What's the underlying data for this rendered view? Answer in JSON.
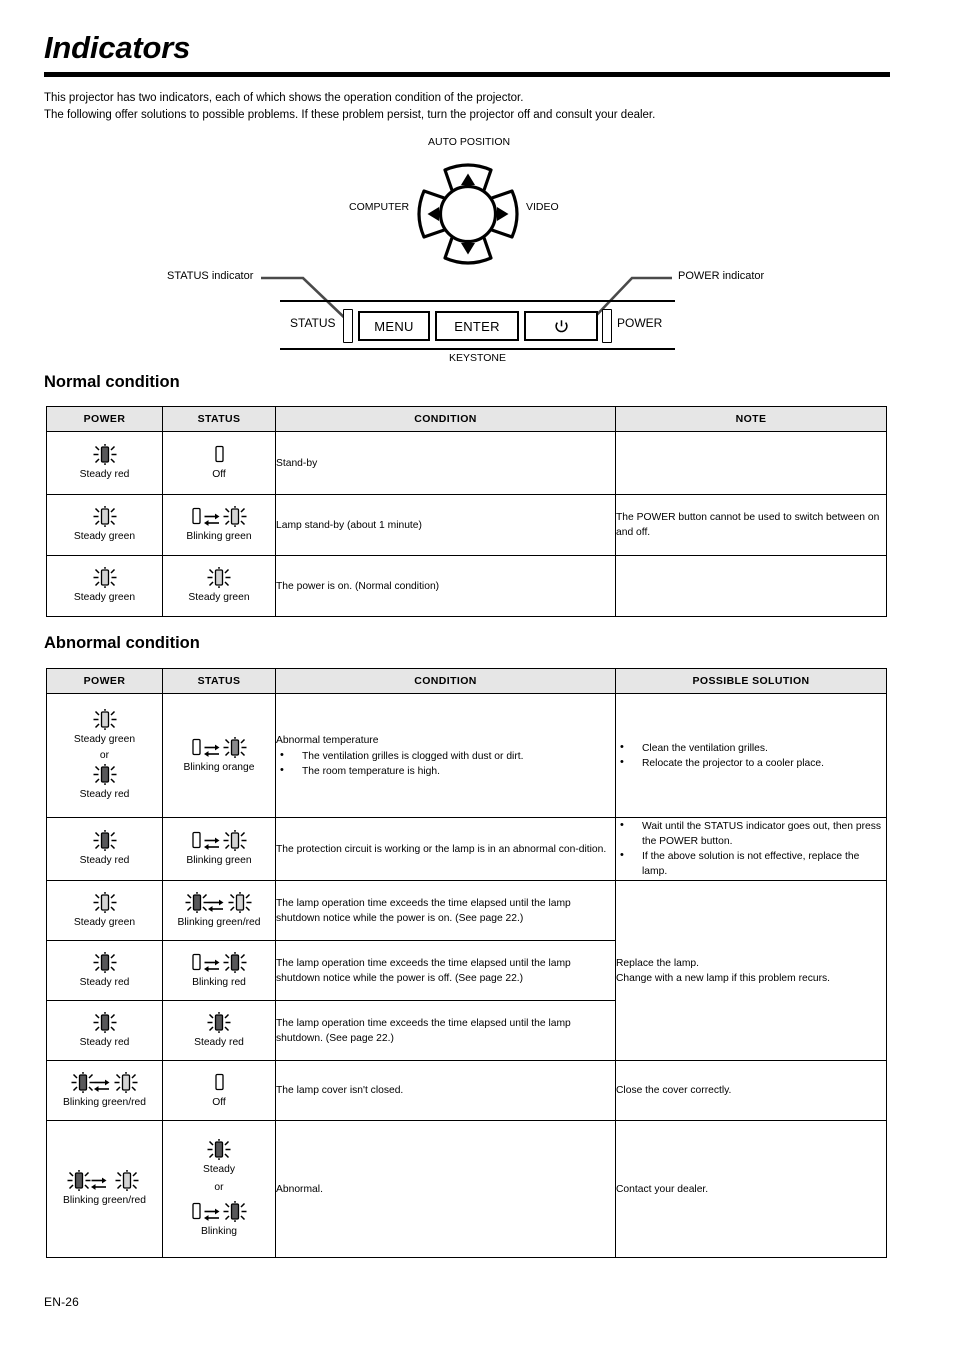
{
  "page": {
    "title": "Indicators",
    "footer": "EN-26",
    "intro_lines": [
      "This projector has two indicators, each of which shows the operation condition of the projector.",
      "The following offer solutions to possible problems. If these problem persist, turn the projector off and consult your dealer."
    ]
  },
  "diagram": {
    "auto_position": "AUTO POSITION",
    "computer": "COMPUTER",
    "video": "VIDEO",
    "status_indicator_label": "STATUS indicator",
    "power_indicator_label": "POWER indicator",
    "status_label": "STATUS",
    "power_label": "POWER",
    "menu_button": "MENU",
    "enter_button": "ENTER",
    "power_button_icon": "power-symbol",
    "keystone": "KEYSTONE"
  },
  "normal": {
    "heading": "Normal condition",
    "columns": [
      "POWER",
      "STATUS",
      "CONDITION",
      "NOTE"
    ],
    "rows": [
      {
        "power": {
          "caption": "Steady red",
          "symbol": "steady-red"
        },
        "status": {
          "caption": "Off",
          "symbol": "off"
        },
        "condition": "Stand-by",
        "note": ""
      },
      {
        "power": {
          "caption": "Steady green",
          "symbol": "steady-green"
        },
        "status": {
          "caption": "Blinking  green",
          "symbol": "blinking-green"
        },
        "condition": "Lamp stand-by (about 1 minute)",
        "note": "The POWER button cannot be used to switch between on and off."
      },
      {
        "power": {
          "caption": "Steady green",
          "symbol": "steady-green"
        },
        "status": {
          "caption": "Steady green",
          "symbol": "steady-green"
        },
        "condition": "The power is on. (Normal condition)",
        "note": ""
      }
    ]
  },
  "abnormal": {
    "heading": "Abnormal condition",
    "columns": [
      "POWER",
      "STATUS",
      "CONDITION",
      "POSSIBLE SOLUTION"
    ],
    "rows": [
      {
        "power": {
          "caption": "Steady green",
          "symbol": "steady-green",
          "or": "or",
          "caption2": "Steady red",
          "symbol2": "steady-red"
        },
        "status": {
          "caption": "Blinking orange",
          "symbol": "blinking-orange"
        },
        "condition_title": "Abnormal temperature",
        "condition_bullets": [
          "The ventilation grilles is clogged with dust or dirt.",
          "The room temperature is high."
        ],
        "solution_bullets": [
          "Clean the ventilation grilles.",
          "Relocate the projector to a cooler place."
        ]
      },
      {
        "power": {
          "caption": "Steady red",
          "symbol": "steady-red"
        },
        "status": {
          "caption": "Blinking  green",
          "symbol": "blinking-green"
        },
        "condition": "The protection circuit is working or the lamp is in an abnormal con-dition.",
        "solution_bullets": [
          "Wait until the STATUS indicator goes out, then press the POWER button.",
          "If the above solution is not effective, replace the lamp."
        ]
      },
      {
        "power": {
          "caption": "Steady green",
          "symbol": "steady-green"
        },
        "status": {
          "caption": "Blinking green/red",
          "symbol": "blinking-green-red"
        },
        "condition": "The lamp operation time exceeds the time elapsed until the lamp shutdown notice while the power is on. (See page 22.)"
      },
      {
        "power": {
          "caption": "Steady red",
          "symbol": "steady-red"
        },
        "status": {
          "caption": "Blinking red",
          "symbol": "blinking-red"
        },
        "condition": "The lamp operation time exceeds the time elapsed until the lamp shutdown notice while the power is off. (See page 22.)"
      },
      {
        "power": {
          "caption": "Steady red",
          "symbol": "steady-red"
        },
        "status": {
          "caption": "Steady red",
          "symbol": "steady-red"
        },
        "condition": "The lamp operation time exceeds the time elapsed until the lamp shutdown. (See page 22.)"
      },
      {
        "power": {
          "caption": "Blinking green/red",
          "symbol": "blinking-green-red"
        },
        "status": {
          "caption": "Off",
          "symbol": "off"
        },
        "condition": "The lamp cover isn't closed.",
        "solution": "Close the cover correctly."
      },
      {
        "power": {
          "caption": "Blinking green/red",
          "symbol": "blinking-green-red"
        },
        "status": {
          "caption": "Steady",
          "symbol": "steady-red",
          "or": "or",
          "caption2": "Blinking",
          "symbol2": "blinking-red"
        },
        "condition": "Abnormal.",
        "solution": "Contact your dealer."
      }
    ],
    "merged_solution_lamp": "Replace the lamp.\nChange with a new lamp if this problem recurs."
  },
  "colors": {
    "lamp_dark": "#58585a",
    "lamp_light": "#d4d4d4",
    "header_bg": "#e6e6e6",
    "ink": "#000000"
  }
}
